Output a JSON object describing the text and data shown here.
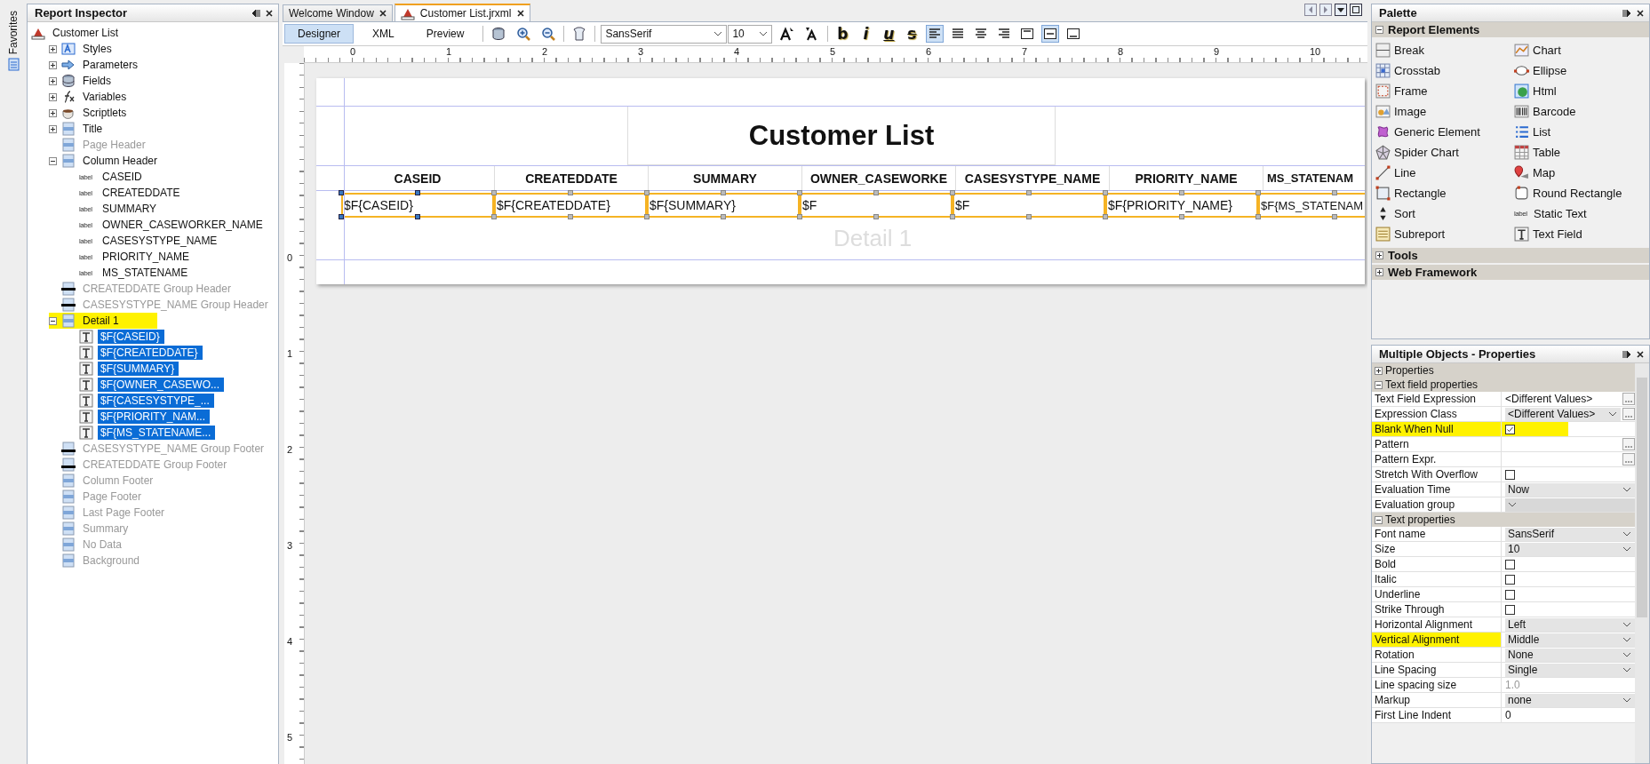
{
  "favorites": {
    "title": "Favorites"
  },
  "inspector": {
    "title": "Report Inspector",
    "tree": {
      "label": "Customer List",
      "kind": "report",
      "children": [
        {
          "label": "Styles",
          "kind": "styles",
          "expanded": false,
          "dimmed": false,
          "highlighted": false
        },
        {
          "label": "Parameters",
          "kind": "parameters",
          "expanded": false,
          "dimmed": false,
          "highlighted": false
        },
        {
          "label": "Fields",
          "kind": "fields",
          "expanded": false,
          "dimmed": false,
          "highlighted": false
        },
        {
          "label": "Variables",
          "kind": "variables",
          "expanded": false,
          "dimmed": false,
          "highlighted": false
        },
        {
          "label": "Scriptlets",
          "kind": "scriptlets",
          "expanded": false,
          "dimmed": false,
          "highlighted": false
        },
        {
          "label": "Title",
          "kind": "band",
          "expanded": false,
          "dimmed": false,
          "highlighted": false
        },
        {
          "label": "Page Header",
          "kind": "band",
          "dimmed": true,
          "highlighted": false
        },
        {
          "label": "Column Header",
          "kind": "band",
          "expanded": true,
          "dimmed": false,
          "highlighted": false,
          "children": [
            {
              "label": "CASEID",
              "kind": "label",
              "badge": "label",
              "selected": false
            },
            {
              "label": "CREATEDDATE",
              "kind": "label",
              "badge": "label",
              "selected": false
            },
            {
              "label": "SUMMARY",
              "kind": "label",
              "badge": "label",
              "selected": false
            },
            {
              "label": "OWNER_CASEWORKER_NAME",
              "kind": "label",
              "badge": "label",
              "selected": false
            },
            {
              "label": "CASESYSTYPE_NAME",
              "kind": "label",
              "badge": "label",
              "selected": false
            },
            {
              "label": "PRIORITY_NAME",
              "kind": "label",
              "badge": "label",
              "selected": false
            },
            {
              "label": "MS_STATENAME",
              "kind": "label",
              "badge": "label",
              "selected": false
            }
          ]
        },
        {
          "label": "CREATEDDATE Group Header",
          "kind": "group-header",
          "dimmed": true,
          "highlighted": false
        },
        {
          "label": "CASESYSTYPE_NAME Group Header",
          "kind": "group-header",
          "dimmed": true,
          "highlighted": false
        },
        {
          "label": "Detail 1",
          "kind": "band",
          "expanded": true,
          "dimmed": false,
          "highlighted": true,
          "children": [
            {
              "label": "$F{CASEID}",
              "kind": "textfield",
              "selected": true
            },
            {
              "label": "$F{CREATEDDATE}",
              "kind": "textfield",
              "selected": true
            },
            {
              "label": "$F{SUMMARY}",
              "kind": "textfield",
              "selected": true
            },
            {
              "label": "$F{OWNER_CASEWO...",
              "kind": "textfield",
              "selected": true
            },
            {
              "label": "$F{CASESYSTYPE_...",
              "kind": "textfield",
              "selected": true
            },
            {
              "label": "$F{PRIORITY_NAM...",
              "kind": "textfield",
              "selected": true
            },
            {
              "label": "$F{MS_STATENAME...",
              "kind": "textfield",
              "selected": true
            }
          ]
        },
        {
          "label": "CASESYSTYPE_NAME Group Footer",
          "kind": "group-footer",
          "dimmed": true,
          "highlighted": false
        },
        {
          "label": "CREATEDDATE Group Footer",
          "kind": "group-footer",
          "dimmed": true,
          "highlighted": false
        },
        {
          "label": "Column Footer",
          "kind": "band",
          "dimmed": true,
          "highlighted": false
        },
        {
          "label": "Page Footer",
          "kind": "band",
          "dimmed": true,
          "highlighted": false
        },
        {
          "label": "Last Page Footer",
          "kind": "band",
          "dimmed": true,
          "highlighted": false
        },
        {
          "label": "Summary",
          "kind": "band",
          "dimmed": true,
          "highlighted": false
        },
        {
          "label": "No Data",
          "kind": "band",
          "dimmed": true,
          "highlighted": false
        },
        {
          "label": "Background",
          "kind": "band",
          "dimmed": true,
          "highlighted": false
        }
      ]
    }
  },
  "editor_tabs": [
    {
      "label": "Welcome Window",
      "selected": false
    },
    {
      "label": "Customer List.jrxml",
      "selected": true
    }
  ],
  "toolbar": {
    "views": [
      {
        "label": "Designer",
        "selected": true
      },
      {
        "label": "XML",
        "selected": false
      },
      {
        "label": "Preview",
        "selected": false
      }
    ],
    "font": "SansSerif",
    "size": "10",
    "format_buttons": [
      "b",
      "i",
      "u",
      "s"
    ],
    "alignment": [
      {
        "kind": "left",
        "selected": true
      },
      {
        "kind": "justify",
        "selected": false
      },
      {
        "kind": "center",
        "selected": false
      },
      {
        "kind": "right",
        "selected": false
      },
      {
        "kind": "top",
        "selected": false
      },
      {
        "kind": "middle",
        "selected": true
      },
      {
        "kind": "bottom",
        "selected": false
      }
    ]
  },
  "ruler": {
    "horizontal": [
      "0",
      "1",
      "2",
      "3",
      "4",
      "5",
      "6",
      "7",
      "8",
      "9",
      "10"
    ],
    "vertical": [
      "0",
      "1",
      "2",
      "3",
      "4",
      "5"
    ]
  },
  "report": {
    "title": "Customer List",
    "columns": [
      "CASEID",
      "CREATEDDATE",
      "SUMMARY",
      "OWNER_CASEWORKE",
      "CASESYSTYPE_NAME",
      "PRIORITY_NAME",
      "MS_STATENAM"
    ],
    "fields": [
      "$F{CASEID}",
      "$F{CREATEDDATE}",
      "$F{SUMMARY}",
      "$F",
      "$F",
      "$F{PRIORITY_NAME}",
      "$F{MS_STATENAM"
    ],
    "detail_band_label": "Detail 1"
  },
  "palette": {
    "title": "Palette",
    "sections": [
      {
        "title": "Report Elements",
        "expanded": true,
        "items": [
          {
            "label": "Break",
            "kind": "break"
          },
          {
            "label": "Chart",
            "kind": "chart"
          },
          {
            "label": "Crosstab",
            "kind": "crosstab"
          },
          {
            "label": "Ellipse",
            "kind": "ellipse"
          },
          {
            "label": "Frame",
            "kind": "frame"
          },
          {
            "label": "Html",
            "kind": "html"
          },
          {
            "label": "Image",
            "kind": "image"
          },
          {
            "label": "Barcode",
            "kind": "barcode"
          },
          {
            "label": "Generic Element",
            "kind": "generic"
          },
          {
            "label": "List",
            "kind": "list"
          },
          {
            "label": "Spider Chart",
            "kind": "spider"
          },
          {
            "label": "Table",
            "kind": "table"
          },
          {
            "label": "Line",
            "kind": "line"
          },
          {
            "label": "Map",
            "kind": "map"
          },
          {
            "label": "Rectangle",
            "kind": "rectangle"
          },
          {
            "label": "Round Rectangle",
            "kind": "roundrect"
          },
          {
            "label": "Sort",
            "kind": "sort"
          },
          {
            "label": "Static Text",
            "kind": "statictext",
            "badge": "label"
          },
          {
            "label": "Subreport",
            "kind": "subreport"
          },
          {
            "label": "Text Field",
            "kind": "textfield"
          }
        ]
      },
      {
        "title": "Tools",
        "expanded": false
      },
      {
        "title": "Web Framework",
        "expanded": false
      }
    ]
  },
  "properties": {
    "title": "Multiple Objects - Properties",
    "sections": [
      {
        "title": "Properties",
        "expanded": false
      },
      {
        "title": "Text field properties",
        "expanded": true,
        "rows": [
          {
            "label": "Text Field Expression",
            "kind": "text",
            "value": "<Different Values>",
            "button": true,
            "highlighted": false,
            "disabled": false
          },
          {
            "label": "Expression Class",
            "kind": "dropdown",
            "value": "<Different Values>",
            "button": true,
            "highlighted": false,
            "disabled": false
          },
          {
            "label": "Blank When Null",
            "kind": "checkbox",
            "checked": true,
            "button": false,
            "highlighted": true,
            "disabled": false
          },
          {
            "label": "Pattern",
            "kind": "text",
            "button": true,
            "highlighted": false,
            "disabled": false
          },
          {
            "label": "Pattern Expr.",
            "kind": "text",
            "button": true,
            "highlighted": false,
            "disabled": false
          },
          {
            "label": "Stretch With Overflow",
            "kind": "checkbox",
            "checked": false,
            "button": false,
            "highlighted": false,
            "disabled": false
          },
          {
            "label": "Evaluation Time",
            "kind": "dropdown",
            "value": "Now",
            "button": false,
            "highlighted": false,
            "disabled": false
          },
          {
            "label": "Evaluation group",
            "kind": "dropdown",
            "button": false,
            "highlighted": false,
            "disabled": true
          }
        ]
      },
      {
        "title": "Text properties",
        "expanded": true,
        "rows": [
          {
            "label": "Font name",
            "kind": "dropdown",
            "value": "SansSerif",
            "button": false,
            "highlighted": false,
            "disabled": false
          },
          {
            "label": "Size",
            "kind": "dropdown",
            "value": "10",
            "button": false,
            "highlighted": false,
            "disabled": false
          },
          {
            "label": "Bold",
            "kind": "checkbox",
            "checked": false,
            "button": false,
            "highlighted": false,
            "disabled": false
          },
          {
            "label": "Italic",
            "kind": "checkbox",
            "checked": false,
            "button": false,
            "highlighted": false,
            "disabled": false
          },
          {
            "label": "Underline",
            "kind": "checkbox",
            "checked": false,
            "button": false,
            "highlighted": false,
            "disabled": false
          },
          {
            "label": "Strike Through",
            "kind": "checkbox",
            "checked": false,
            "button": false,
            "highlighted": false,
            "disabled": false
          },
          {
            "label": "Horizontal Alignment",
            "kind": "dropdown",
            "value": "Left",
            "button": false,
            "highlighted": false,
            "disabled": false
          },
          {
            "label": "Vertical Alignment",
            "kind": "dropdown",
            "value": "Middle",
            "button": false,
            "highlighted": true,
            "disabled": false
          },
          {
            "label": "Rotation",
            "kind": "dropdown",
            "value": "None",
            "button": false,
            "highlighted": false,
            "disabled": false
          },
          {
            "label": "Line Spacing",
            "kind": "dropdown",
            "value": "Single",
            "button": false,
            "highlighted": false,
            "disabled": false
          },
          {
            "label": "Line spacing size",
            "kind": "text",
            "value": "1.0",
            "button": false,
            "highlighted": false,
            "disabled": true
          },
          {
            "label": "Markup",
            "kind": "dropdown",
            "value": "none",
            "button": false,
            "highlighted": false,
            "disabled": false
          },
          {
            "label": "First Line Indent",
            "kind": "text",
            "value": "0",
            "button": false,
            "highlighted": false,
            "disabled": false
          }
        ]
      }
    ]
  }
}
